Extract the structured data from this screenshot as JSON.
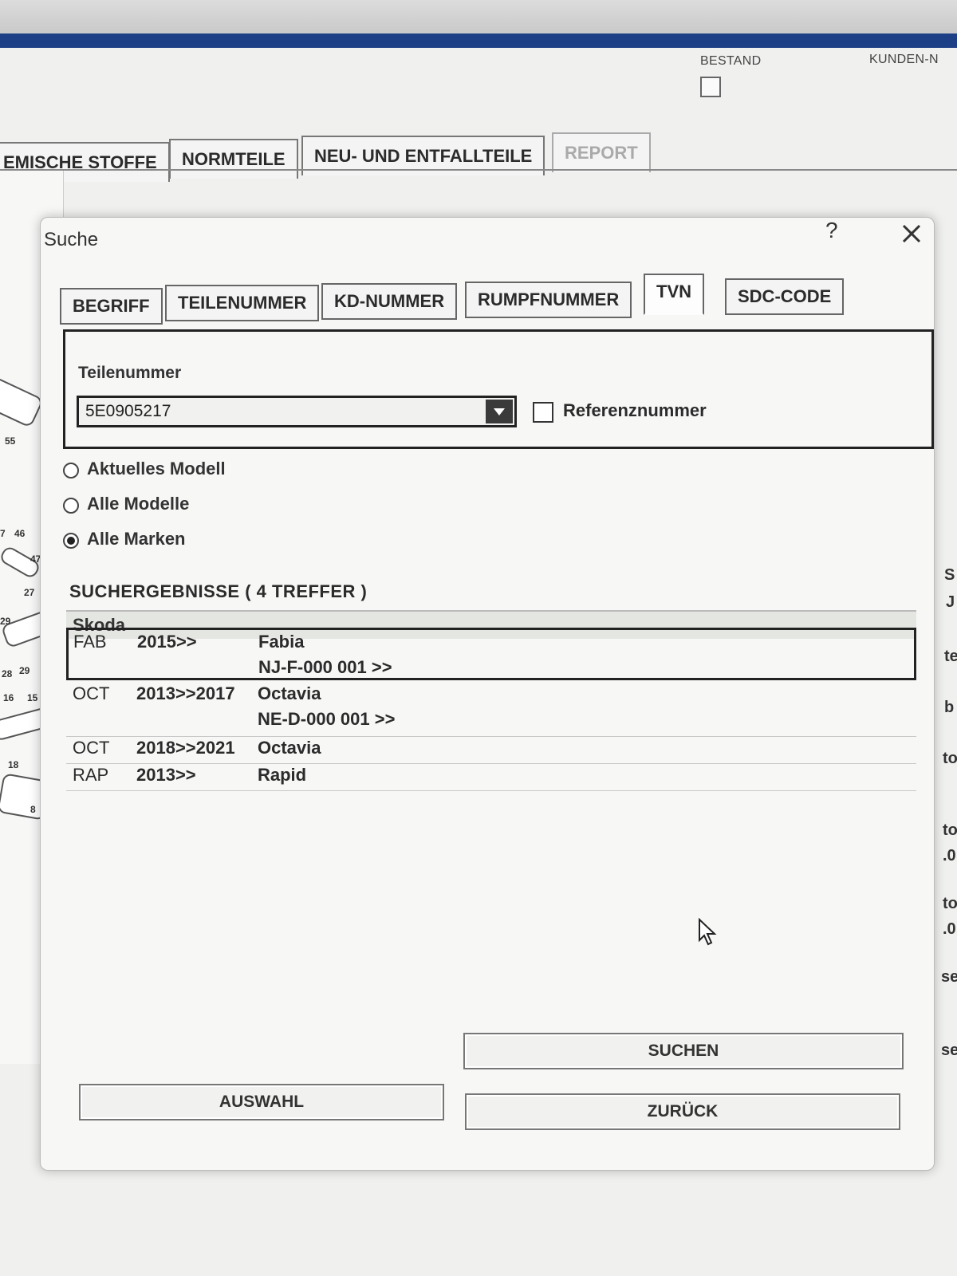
{
  "header": {
    "bestand_label": "BESTAND",
    "kunden_label": "KUNDEN-N"
  },
  "main_tabs": [
    {
      "label": "EMISCHE STOFFE"
    },
    {
      "label": "NORMTEILE"
    },
    {
      "label": "NEU- UND ENTFALLTEILE"
    },
    {
      "label": "REPORT"
    }
  ],
  "diagram_numbers": [
    "55",
    "7",
    "46",
    "47",
    "27",
    "29",
    "28",
    "29",
    "16",
    "15",
    "18",
    "8"
  ],
  "right_fragments": [
    "S",
    "J",
    "te",
    "b",
    "to",
    "to",
    ".0",
    "to",
    ".0",
    "se",
    "se"
  ],
  "dialog": {
    "title": "Suche",
    "help": "?",
    "tabs": [
      {
        "label": "BEGRIFF"
      },
      {
        "label": "TEILENUMMER"
      },
      {
        "label": "KD-NUMMER"
      },
      {
        "label": "RUMPFNUMMER"
      },
      {
        "label": "TVN"
      },
      {
        "label": "SDC-CODE"
      }
    ],
    "field_label": "Teilenummer",
    "field_value": "5E0905217",
    "reference_label": "Referenznummer",
    "radios": [
      {
        "label": "Aktuelles Modell",
        "checked": false
      },
      {
        "label": "Alle Modelle",
        "checked": false
      },
      {
        "label": "Alle Marken",
        "checked": true
      }
    ],
    "results_title": "SUCHERGEBNISSE  ( 4 TREFFER )",
    "group": "Skoda",
    "results": [
      {
        "code": "FAB",
        "years": "2015>>",
        "model": "Fabia",
        "sub": "NJ-F-000 001 >>"
      },
      {
        "code": "OCT",
        "years": "2013>>2017",
        "model": "Octavia",
        "sub": "NE-D-000 001 >>"
      },
      {
        "code": "OCT",
        "years": "2018>>2021",
        "model": "Octavia",
        "sub": ""
      },
      {
        "code": "RAP",
        "years": "2013>>",
        "model": "Rapid",
        "sub": ""
      }
    ],
    "buttons": {
      "search": "SUCHEN",
      "select": "AUSWAHL",
      "back": "ZURÜCK"
    }
  }
}
